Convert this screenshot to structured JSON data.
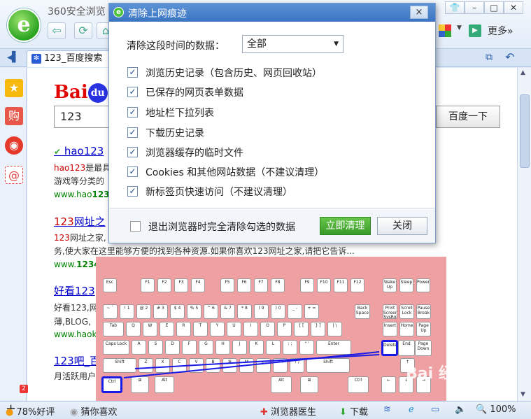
{
  "window": {
    "title": "360安全浏览",
    "more_label": "更多»"
  },
  "tab": {
    "label": "123_百度搜索"
  },
  "page": {
    "search_value": "123",
    "search_button": "百度一下",
    "results": [
      {
        "title_hl": "hao123",
        "title_rest": "",
        "desc_hl": "hao123",
        "desc": "是最具",
        "desc2": "游戏等分类的",
        "url_prefix": "www.hao",
        "url_hl": "123",
        "url_suffix": "."
      },
      {
        "title_hl": "123",
        "title_rest": "网址之",
        "desc_hl": "123",
        "desc": "网址之家,",
        "desc2": "务,使大家在这里能够方便的找到各种资源.如果你喜欢123网址之家,请把它告诉...",
        "url_prefix": "www.",
        "url_hl": "1234",
        "url_suffix": ""
      },
      {
        "title_hl": "",
        "title_rest": "好看123",
        "desc_hl": "",
        "desc": "好看123,网",
        "desc2": "薄,BLOG,",
        "url_prefix": "www.haok",
        "url_hl": "",
        "url_suffix": ""
      },
      {
        "title_hl": "",
        "title_rest": "123吧_百",
        "desc_hl": "",
        "desc": "月活跃用户",
        "desc2": "",
        "url_prefix": "",
        "url_hl": "",
        "url_suffix": ""
      }
    ]
  },
  "dialog": {
    "title": "清除上网痕迹",
    "close_glyph": "×",
    "range_label": "清除这段时间的数据：",
    "range_value": "全部",
    "options": [
      {
        "label": "浏览历史记录（包含历史、网页回收站）",
        "checked": true
      },
      {
        "label": "已保存的网页表单数据",
        "checked": true
      },
      {
        "label": "地址栏下拉列表",
        "checked": true
      },
      {
        "label": "下载历史记录",
        "checked": true
      },
      {
        "label": "浏览器缓存的临时文件",
        "checked": true
      },
      {
        "label": "Cookies 和其他网站数据（不建议清理）",
        "checked": true
      },
      {
        "label": "新标签页快速访问（不建议清理）",
        "checked": true
      }
    ],
    "exit_clear_label": "退出浏览器时完全清除勾选的数据",
    "clean_button": "立即清理",
    "close_button": "关闭"
  },
  "keyboard": {
    "row_fn": [
      "Esc",
      "F1",
      "F2",
      "F3",
      "F4",
      "F5",
      "F6",
      "F7",
      "F8",
      "F9",
      "F10",
      "F11",
      "F12",
      "Wake Up",
      "Sleep",
      "Power"
    ],
    "row_num": [
      "~ `",
      "! 1",
      "@ 2",
      "# 3",
      "$ 4",
      "% 5",
      "^ 6",
      "& 7",
      "* 8",
      "( 9",
      ") 0",
      "_ -",
      "+ =",
      "Back Space",
      "Print Screen SysRq",
      "Scroll Lock",
      "Pause Break"
    ],
    "row_q": [
      "Tab",
      "Q",
      "W",
      "E",
      "R",
      "T",
      "Y",
      "U",
      "I",
      "O",
      "P",
      "{ [",
      "} ]",
      "| \\",
      "Insert",
      "Home",
      "Page Up"
    ],
    "row_a": [
      "Caps Lock",
      "A",
      "S",
      "D",
      "F",
      "G",
      "H",
      "J",
      "K",
      "L",
      ": ;",
      "\" '",
      "Enter",
      "Delete",
      "End",
      "Page Down"
    ],
    "row_z": [
      "Shift",
      "Z",
      "X",
      "C",
      "V",
      "B",
      "N",
      "M",
      "< ,",
      "> .",
      "? /",
      "Shift",
      "↑"
    ],
    "row_bottom": [
      "Ctrl",
      "⊞",
      "Alt",
      "Alt",
      "⊞",
      "Ctrl",
      "←",
      "↓",
      "→"
    ]
  },
  "status": {
    "rating": "78%好评",
    "guess": "猜你喜欢",
    "doctor": "浏览器医生",
    "download": "下载",
    "zoom": "100%",
    "badge": "2"
  },
  "watermark": "Bai 经验"
}
